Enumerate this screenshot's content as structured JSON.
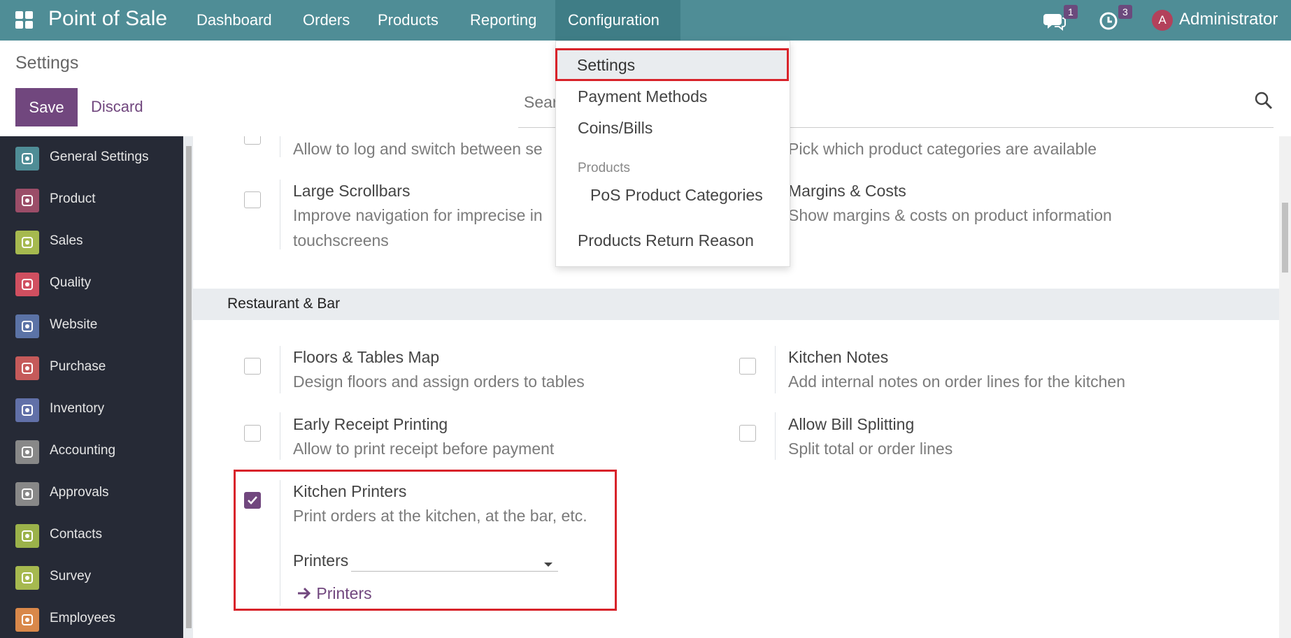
{
  "topbar": {
    "brand": "Point of Sale",
    "nav": [
      "Dashboard",
      "Orders",
      "Products",
      "Reporting",
      "Configuration"
    ],
    "messages_badge": "1",
    "activities_badge": "3",
    "avatar_initial": "A",
    "user_name": "Administrator"
  },
  "control_panel": {
    "breadcrumb": "Settings",
    "save_label": "Save",
    "discard_label": "Discard",
    "search_placeholder": "Search..."
  },
  "sidebar": {
    "items": [
      {
        "label": "General Settings",
        "color": "#4f8d96"
      },
      {
        "label": "Product",
        "color": "#9b4d68"
      },
      {
        "label": "Sales",
        "color": "#a6b94f"
      },
      {
        "label": "Quality",
        "color": "#d04f60"
      },
      {
        "label": "Website",
        "color": "#5b73a6"
      },
      {
        "label": "Purchase",
        "color": "#c55a5a"
      },
      {
        "label": "Inventory",
        "color": "#6170a8"
      },
      {
        "label": "Accounting",
        "color": "#888888"
      },
      {
        "label": "Approvals",
        "color": "#888888"
      },
      {
        "label": "Contacts",
        "color": "#9bb24a"
      },
      {
        "label": "Survey",
        "color": "#a6b94f"
      },
      {
        "label": "Employees",
        "color": "#d9884a"
      }
    ]
  },
  "settings_top": {
    "partial_left_desc": "Allow to log and switch between se",
    "partial_right_desc": "Pick which product categories are available",
    "large_scrollbars_title": "Large Scrollbars",
    "large_scrollbars_desc_1": "Improve navigation for imprecise in",
    "large_scrollbars_desc_2": "touchscreens",
    "margins_title": "Margins & Costs",
    "margins_desc": "Show margins & costs on product information"
  },
  "restaurant": {
    "section_title": "Restaurant & Bar",
    "floors_title": "Floors & Tables Map",
    "floors_desc": "Design floors and assign orders to tables",
    "kitchen_notes_title": "Kitchen Notes",
    "kitchen_notes_desc": "Add internal notes on order lines for the kitchen",
    "early_receipt_title": "Early Receipt Printing",
    "early_receipt_desc": "Allow to print receipt before payment",
    "bill_split_title": "Allow Bill Splitting",
    "bill_split_desc": "Split total or order lines",
    "kitchen_printers_title": "Kitchen Printers",
    "kitchen_printers_desc": "Print orders at the kitchen, at the bar, etc.",
    "kitchen_printers_checked": true,
    "printers_field_label": "Printers",
    "printers_link": "Printers"
  },
  "dropdown": {
    "settings": "Settings",
    "payment_methods": "Payment Methods",
    "coins_bills": "Coins/Bills",
    "products_header": "Products",
    "pos_categories": "PoS Product Categories",
    "return_reason": "Products Return Reason"
  },
  "colors": {
    "topbar": "#4f8d96",
    "primary": "#71477e",
    "highlight": "#d8232a",
    "sidebar": "#262a36"
  }
}
